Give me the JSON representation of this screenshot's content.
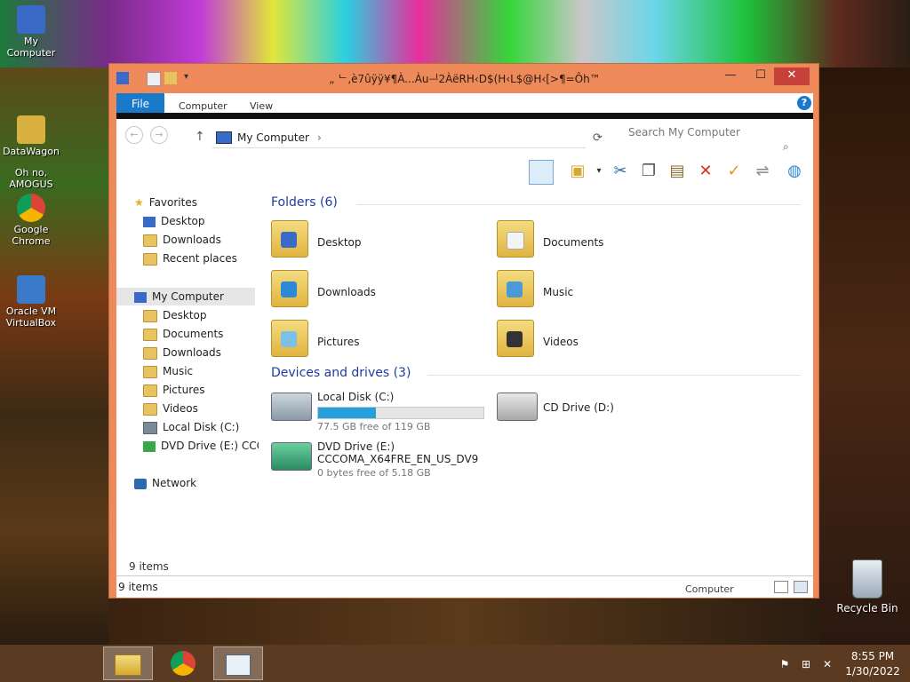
{
  "desktop": {
    "icons": [
      {
        "label": "My Computer"
      },
      {
        "label": "DataWagon"
      },
      {
        "label": "Oh no, AMOGUS"
      },
      {
        "label": "Google Chrome"
      },
      {
        "label": "Oracle VM VirtualBox"
      }
    ],
    "recycle_bin": "Recycle Bin"
  },
  "window": {
    "title": "„ ᄂ,è7ûÿÿ¥¶À...Àuᆜ2ÀëRH‹D$(H‹L$@H‹[>¶=Ôh™",
    "controls": {
      "minimize": "—",
      "maximize": "☐",
      "close": "✕"
    },
    "ribbon": {
      "file": "File",
      "tabs": [
        "Computer",
        "View"
      ],
      "help": "?"
    },
    "address": {
      "path": "My Computer",
      "separator": "›"
    },
    "search": {
      "placeholder": "Search My Computer"
    },
    "nav": {
      "favorites_header": "Favorites",
      "favorites": [
        "Desktop",
        "Downloads",
        "Recent places"
      ],
      "computer_header": "My Computer",
      "computer_items": [
        "Desktop",
        "Documents",
        "Downloads",
        "Music",
        "Pictures",
        "Videos",
        "Local Disk (C:)",
        "DVD Drive (E:) CCCC"
      ],
      "network": "Network"
    },
    "content": {
      "folders_header": "Folders (6)",
      "folders": [
        "Desktop",
        "Documents",
        "Downloads",
        "Music",
        "Pictures",
        "Videos"
      ],
      "devices_header": "Devices and drives (3)",
      "drives": [
        {
          "name": "Local Disk (C:)",
          "free": "77.5 GB free of 119 GB",
          "used_fraction": 0.35
        },
        {
          "name": "CD Drive (D:)"
        },
        {
          "name": "DVD Drive (E:) CCCOMA_X64FRE_EN_US_DV9",
          "free": "0 bytes free of 5.18 GB"
        }
      ]
    },
    "status_inner": "9 items",
    "status_outer": "9 items",
    "status_location": "Computer"
  },
  "taskbar": {
    "clock_time": "8:55 PM",
    "clock_date": "1/30/2022"
  },
  "colors": {
    "accent": "#1979ca",
    "titlebar": "#ee8a5a",
    "close": "#c8403a"
  }
}
